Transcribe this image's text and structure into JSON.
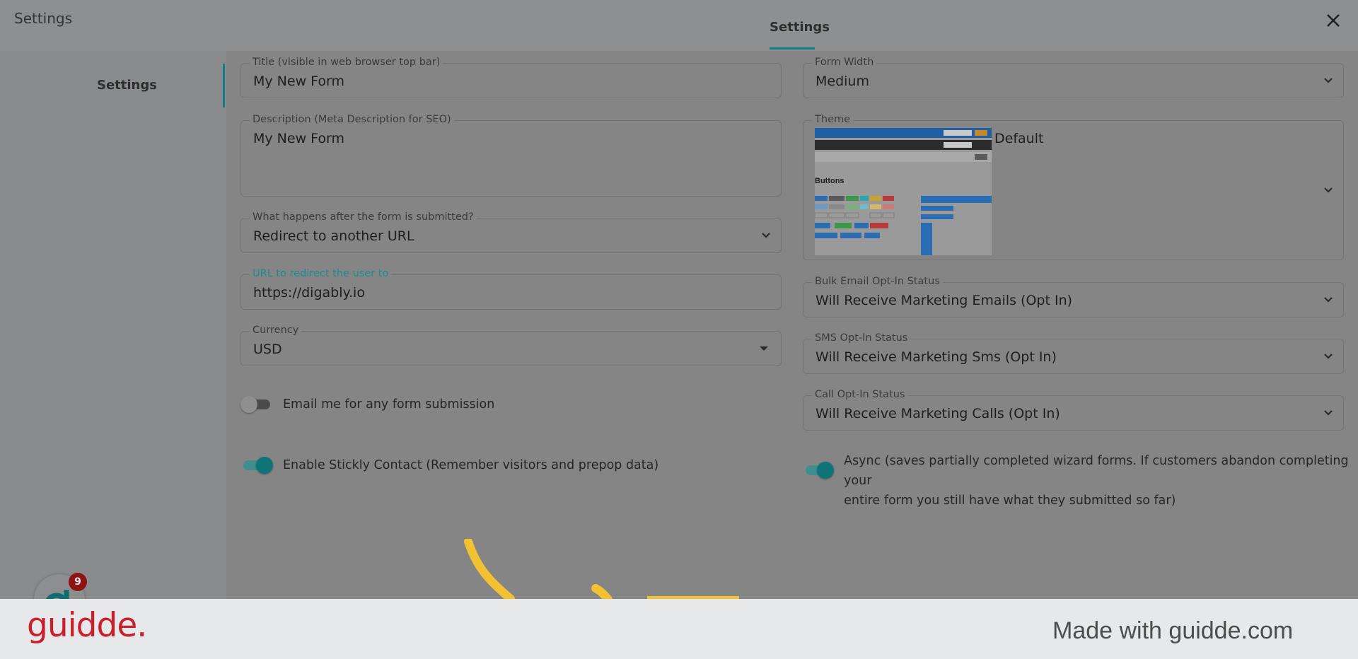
{
  "header": {
    "app_title": "Settings",
    "tab_label": "Settings",
    "close_icon": "close-icon"
  },
  "sidebar": {
    "items": [
      {
        "label": "Settings"
      }
    ]
  },
  "form": {
    "title": {
      "label": "Title (visible in web browser top bar)",
      "value": "My New Form"
    },
    "description": {
      "label": "Description (Meta Description for SEO)",
      "value": "My New Form"
    },
    "after_submit": {
      "label": "What happens after the form is submitted?",
      "value": "Redirect to another URL"
    },
    "redirect_url": {
      "label": "URL to redirect the user to",
      "value": "https://digably.io"
    },
    "currency": {
      "label": "Currency",
      "value": "USD"
    },
    "email_toggle": {
      "label": "Email me for any form submission",
      "on": false
    },
    "sticky_toggle": {
      "label": "Enable Stickly Contact (Remember visitors and prepop data)",
      "on": true
    },
    "form_width": {
      "label": "Form Width",
      "value": "Medium"
    },
    "theme": {
      "label": "Theme",
      "value": "Default",
      "preview_heading": "Buttons"
    },
    "bulk_email": {
      "label": "Bulk Email Opt-In Status",
      "value": "Will Receive Marketing Emails (Opt In)"
    },
    "sms": {
      "label": "SMS Opt-In Status",
      "value": "Will Receive Marketing Sms (Opt In)"
    },
    "call": {
      "label": "Call Opt-In Status",
      "value": "Will Receive Marketing Calls (Opt In)"
    },
    "async_toggle": {
      "label_line1": "Async (saves partially completed wizard forms. If customers abandon completing your",
      "label_line2": "entire form you still have what they submitted so far)",
      "on": true
    }
  },
  "notification_badge": "9",
  "footer": {
    "brand": "guidde.",
    "made_with": "Made with guidde.com"
  },
  "colors": {
    "accent": "#0e7f84",
    "brand_red": "#c9202b",
    "annotation_yellow": "#f2c232"
  }
}
